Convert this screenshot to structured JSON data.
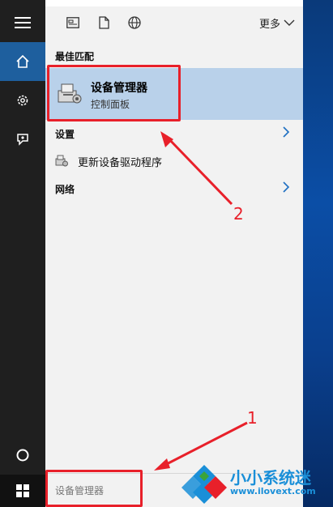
{
  "toolbar": {
    "more_label": "更多"
  },
  "best_match": {
    "section_title": "最佳匹配",
    "name": "设备管理器",
    "subtitle": "控制面板"
  },
  "settings": {
    "section_title": "设置",
    "items": [
      {
        "label": "更新设备驱动程序"
      }
    ]
  },
  "network": {
    "section_title": "网络"
  },
  "search": {
    "value": "设备管理器"
  },
  "annotations": {
    "step1": "1",
    "step2": "2"
  },
  "watermark": {
    "title": "小小系统迷",
    "url": "www.ilovext.com"
  },
  "colors": {
    "accent": "#1e5f9e",
    "highlight": "#b9d1ea",
    "annotation": "#e8202a",
    "watermark": "#1a8fd8"
  }
}
